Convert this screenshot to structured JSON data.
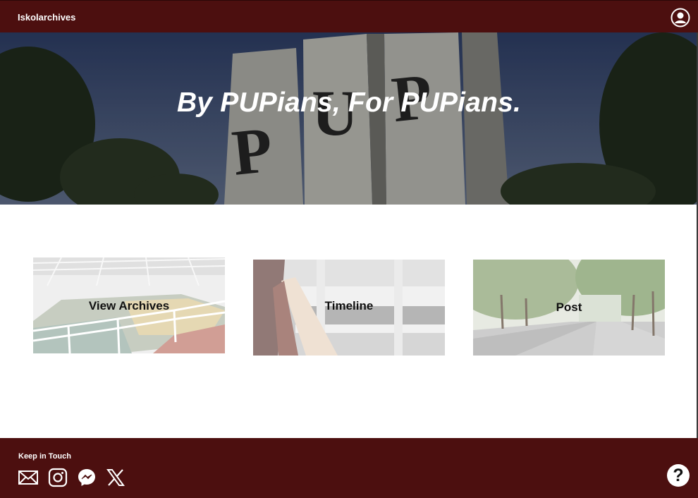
{
  "header": {
    "brand": "Iskolarchives",
    "profile_icon": "user-circle-icon"
  },
  "hero": {
    "title": "By PUPians, For PUPians.",
    "image": "pup-monument-photo"
  },
  "cards": [
    {
      "label": "View Archives",
      "image": "gymnasium-photo"
    },
    {
      "label": "Timeline",
      "image": "building-balcony-photo"
    },
    {
      "label": "Post",
      "image": "campus-walkway-photo"
    }
  ],
  "footer": {
    "title": "Keep in Touch",
    "social_icons": [
      "mail-icon",
      "instagram-icon",
      "messenger-icon",
      "x-icon"
    ],
    "help_symbol": "?"
  },
  "colors": {
    "brand": "#4c0f0f",
    "hero_text": "#ffffff"
  }
}
